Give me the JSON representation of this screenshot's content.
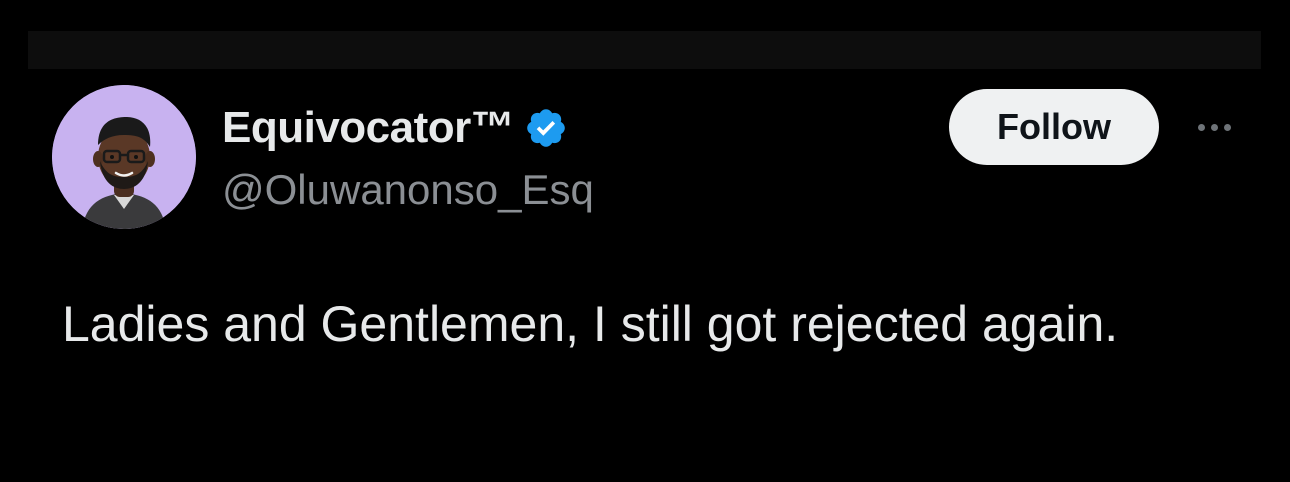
{
  "author": {
    "display_name": "Equivocator™",
    "handle": "@Oluwanonso_Esq",
    "avatar_icon": "memoji-avatar-icon",
    "verified_icon": "verified-badge-icon",
    "verified_color": "#1d9bf0"
  },
  "actions": {
    "follow_label": "Follow",
    "more_icon": "more-options-icon"
  },
  "tweet": {
    "text": "Ladies and Gentlemen, I still got rejected again."
  },
  "colors": {
    "background": "#000000",
    "primary_text": "#e7e9ea",
    "secondary_text": "#8b8f94",
    "avatar_bg": "#c8b2f0",
    "follow_bg": "#eff1f2"
  }
}
